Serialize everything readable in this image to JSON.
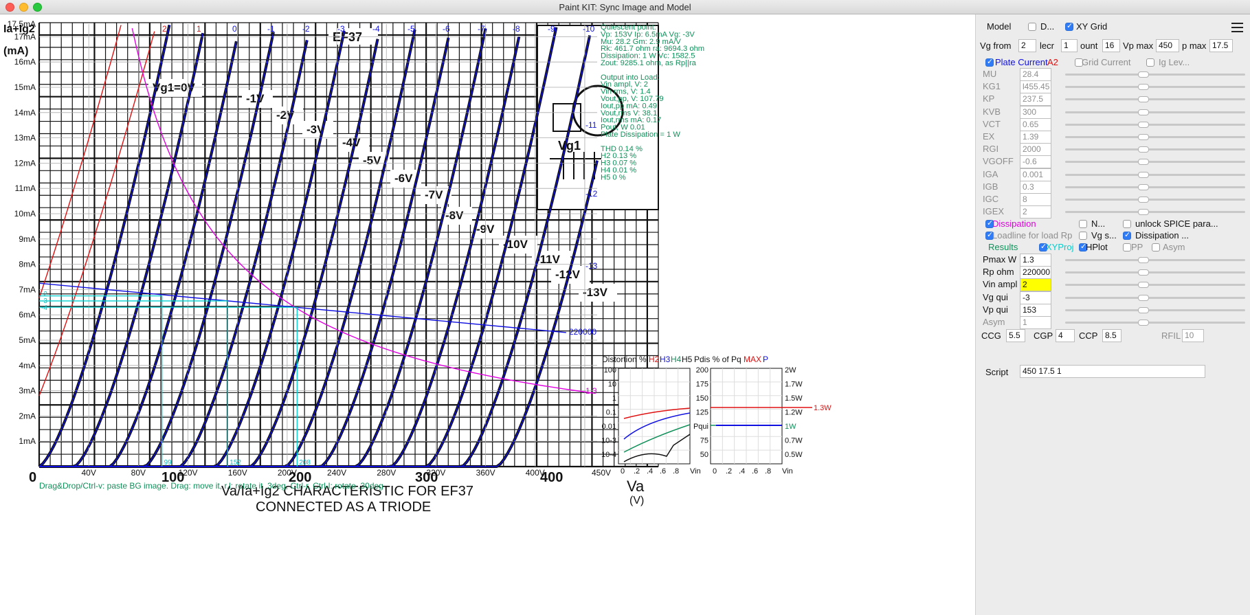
{
  "window": {
    "title": "Paint KIT: Sync Image and Model"
  },
  "plot": {
    "ylabel_top": "Ia+Ig2",
    "ylabel_unit": "(mA)",
    "y_ticks": [
      "1mA",
      "2mA",
      "3mA",
      "4mA",
      "5mA",
      "6mA",
      "7mA",
      "8mA",
      "9mA",
      "10mA",
      "11mA",
      "12mA",
      "13mA",
      "14mA",
      "15mA",
      "16mA",
      "17mA",
      "17.5mA"
    ],
    "x_ticks": [
      "40V",
      "80V",
      "120V",
      "160V",
      "200V",
      "240V",
      "280V",
      "320V",
      "360V",
      "400V",
      "450V"
    ],
    "bg_x_ticks": [
      "0",
      "100",
      "200",
      "300",
      "400"
    ],
    "bg_title_line1": "Va/Ia+Ig2 CHARACTERISTIC FOR EF37",
    "bg_title_line2": "CONNECTED AS A TRIODE",
    "bg_va_label": "Va",
    "bg_va_unit": "(V)",
    "bg_tube": "EF37",
    "bg_curve_labels": [
      "Vg1=0V",
      "-1V",
      "-2V",
      "-3V",
      "-4V",
      "-5V",
      "-6V",
      "-7V",
      "-8V",
      "-9V",
      "-10V",
      "-11V",
      "-12V",
      "-13V"
    ],
    "bg_vg1": "Vg1",
    "grid_top_labels": [
      "0",
      "-1",
      "-2",
      "-3",
      "-4",
      "-5",
      "-6",
      "-7",
      "-8",
      "-9",
      "-10"
    ],
    "grid_right_labels": [
      "-11",
      "-12",
      "-13"
    ],
    "red_top_labels": [
      "2",
      "1"
    ],
    "loadline_label": "220000",
    "diss_label": "1.3",
    "cyan_labels": [
      "-2",
      "-3",
      "-4"
    ],
    "cyan_bottom_labels": [
      "99",
      "152",
      "208"
    ],
    "hint": "Drag&Drop/Ctrl-v: paste BG image. Drag: move it, r,l: rotate it .3deg, Ctrl-r, Ctrl-l: rotate .30deg"
  },
  "info": {
    "lines": [
      "Quiescent point:",
      "Vp: 153V  Ip: 6.5mA  Vg: -3V",
      "Mu: 28.2 Gm: 2.9 mA/V",
      "Rk: 461.7 ohm ra: 9694.3 ohm",
      "Dissipation: 1 W Vc: 1582.5",
      "Zout: 9285.1 ohm, as Rp||ra",
      "",
      "Output into Load:",
      "Vin ampl, V: 2",
      "Vin rms,  V: 1.4",
      "Vout,pp,    V: 107.79",
      "Iout,pp    mA: 0.49",
      "Vout,rms   V: 38.1",
      "Iout,rms  mA: 0.17",
      "Pout, W       0.01",
      "Plate Dissipation = 1 W",
      "",
      "THD 0.14 %",
      "  H2 0.13 %",
      "  H3 0.07 %",
      "  H4 0.01 %",
      "  H5 0 %"
    ]
  },
  "distortion": {
    "title_prefix": "Distortion %",
    "h2": "H2",
    "h3": "H3",
    "h4": "H4",
    "h5": "H5",
    "y_ticks": [
      "100",
      "10",
      "1",
      "0.1",
      "0.01",
      "10-3",
      "10-4"
    ],
    "x_ticks": [
      "0",
      ".2",
      ".4",
      ".6",
      ".8",
      "Vin"
    ]
  },
  "pdis": {
    "title_prefix": "Pdis % of Pq",
    "max": "MAX",
    "p": "P",
    "left_ticks": [
      "200",
      "175",
      "150",
      "125",
      "Pqui",
      "75",
      "50"
    ],
    "right_ticks": [
      "2W",
      "1.7W",
      "1.5W",
      "1.2W",
      "1W",
      "0.7W",
      "0.5W"
    ],
    "max_label": "1.3W",
    "x_ticks": [
      "0",
      ".2",
      ".4",
      ".6",
      ".8",
      "Vin"
    ]
  },
  "chart_data": {
    "type": "line",
    "title": "",
    "xlabel": "",
    "ylabel": "",
    "xlim": [
      0,
      450
    ],
    "ylim": [
      0,
      17.5
    ],
    "series": [],
    "loadline": {
      "name": "220000",
      "x": [
        0,
        425
      ],
      "y": [
        7.25,
        5.3
      ]
    },
    "quiescent": {
      "x": 153,
      "y": 6.5
    },
    "vg_curves": [
      0,
      -1,
      -2,
      -3,
      -4,
      -5,
      -6,
      -7,
      -8,
      -9,
      -10,
      -11,
      -12,
      -13
    ]
  },
  "panel": {
    "model_label": "Model",
    "d_label": "D...",
    "xygrid_label": "XY Grid",
    "vg_from_label": "Vg from",
    "vg_from": "2",
    "decr_label": "lecr",
    "decr": "1",
    "count_label": "ount",
    "count": "16",
    "vpmax_label": "Vp max",
    "vpmax": "450",
    "ipmax_label": "p max",
    "ipmax": "17.5",
    "plate_current_label": "Plate Current",
    "a2_label": "A2",
    "grid_current_label": "Grid Current",
    "ig_lev_label": "Ig Lev...",
    "params": [
      {
        "name": "MU",
        "value": "28.4"
      },
      {
        "name": "KG1",
        "value": "l455.45"
      },
      {
        "name": "KP",
        "value": "237.5"
      },
      {
        "name": "KVB",
        "value": "300"
      },
      {
        "name": "VCT",
        "value": "0.65"
      },
      {
        "name": "EX",
        "value": "1.39"
      },
      {
        "name": "RGI",
        "value": "2000"
      },
      {
        "name": "VGOFF",
        "value": "-0.6"
      },
      {
        "name": "IGA",
        "value": "0.001"
      },
      {
        "name": "IGB",
        "value": "0.3"
      },
      {
        "name": "IGC",
        "value": "8"
      },
      {
        "name": "IGEX",
        "value": "2"
      }
    ],
    "dissipation_label": "Dissipation",
    "n_label": "N...",
    "unlock_label": "unlock SPICE para...",
    "loadline_label": "Loadline for load Rp",
    "vgs_label": "Vg s...",
    "dissipation2_label": "Dissipation ...",
    "results_label": "Results",
    "xyproj_label": "XYProj",
    "hplot_label": "HPlot",
    "pp_label": "PP",
    "asym_label": "Asym",
    "loadparams": [
      {
        "name": "Pmax W",
        "value": "1.3"
      },
      {
        "name": "Rp ohm",
        "value": "220000"
      },
      {
        "name": "Vin ampl",
        "value": "2"
      },
      {
        "name": "Vg qui",
        "value": "-3"
      },
      {
        "name": "Vp qui",
        "value": "153"
      },
      {
        "name": "Asym",
        "value": "1"
      }
    ],
    "ccg_label": "CCG",
    "ccg": "5.5",
    "cgp_label": "CGP",
    "cgp": "4",
    "ccp_label": "CCP",
    "ccp": "8.5",
    "rfil_label": "RFIL",
    "rfil": "10",
    "script_label": "Script",
    "script_value": "450 17.5 1"
  }
}
